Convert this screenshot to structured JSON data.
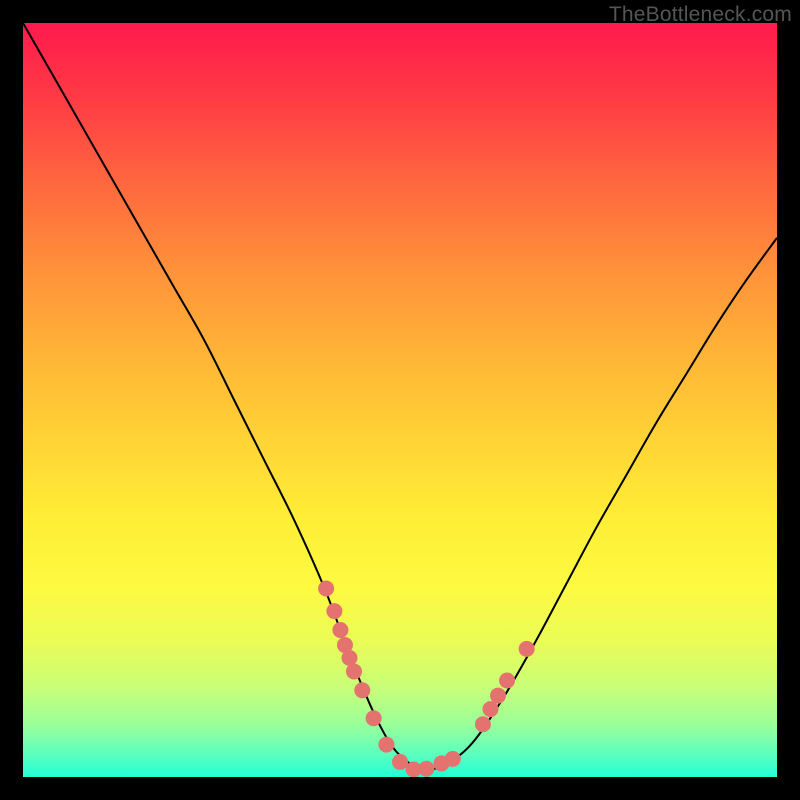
{
  "watermark": "TheBottleneck.com",
  "chart_data": {
    "type": "line",
    "title": "",
    "xlabel": "",
    "ylabel": "",
    "xlim": [
      0,
      100
    ],
    "ylim": [
      0,
      100
    ],
    "background": "rainbow-gradient",
    "series": [
      {
        "name": "curve",
        "x": [
          0,
          4,
          8,
          12,
          16,
          20,
          24,
          28,
          32,
          36,
          40,
          43,
          45,
          47,
          49,
          51,
          53,
          55,
          57,
          60,
          64,
          68,
          72,
          76,
          80,
          84,
          88,
          92,
          96,
          100
        ],
        "y": [
          100,
          93,
          86,
          79,
          72,
          65,
          58,
          50,
          42,
          34,
          25,
          17,
          12,
          7.5,
          4,
          2,
          1,
          1.2,
          2.2,
          5,
          11,
          18,
          25.5,
          33,
          40,
          47,
          53.5,
          60,
          66,
          71.5
        ]
      }
    ],
    "markers": {
      "name": "markers",
      "x": [
        40.2,
        41.3,
        42.1,
        42.7,
        43.3,
        43.9,
        45.0,
        46.5,
        48.2,
        50.0,
        51.8,
        53.5,
        55.5,
        57.0,
        61.0,
        62.0,
        63.0,
        64.2,
        66.8
      ],
      "y": [
        25.0,
        22.0,
        19.5,
        17.5,
        15.8,
        14.0,
        11.5,
        7.8,
        4.3,
        2.0,
        1.0,
        1.1,
        1.8,
        2.4,
        7.0,
        9.0,
        10.8,
        12.8,
        17.0
      ]
    }
  }
}
